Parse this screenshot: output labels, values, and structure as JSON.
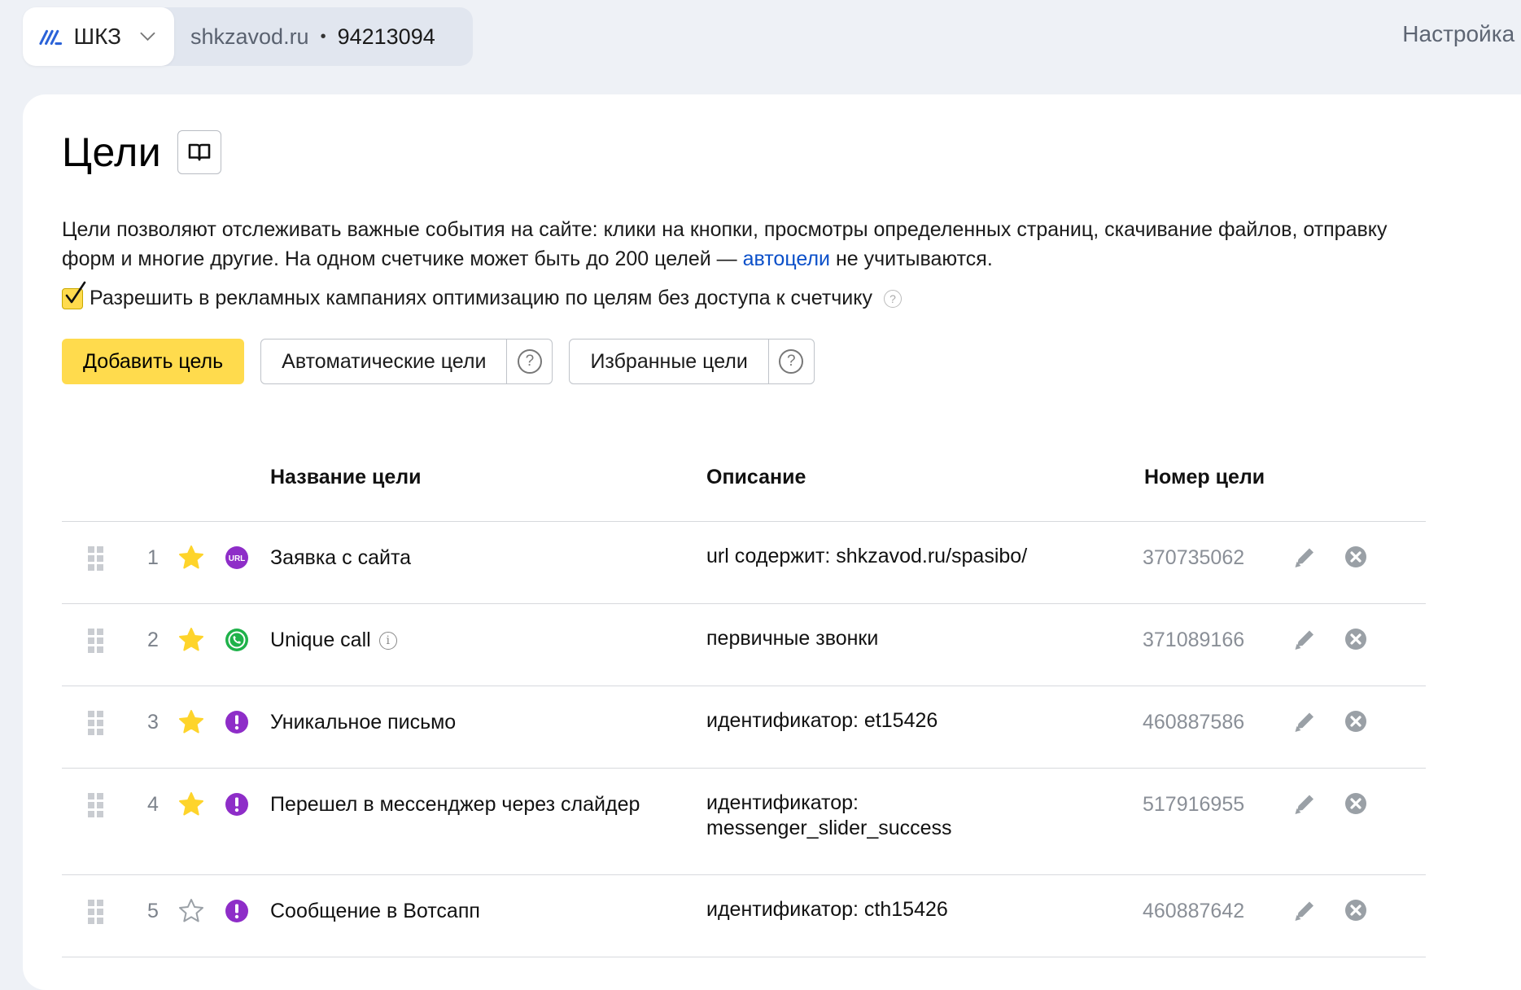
{
  "header": {
    "brand_name": "ШКЗ",
    "site": "shkzavod.ru",
    "separator": "•",
    "counter_id": "94213094",
    "right_link": "Настройка акк"
  },
  "page": {
    "title": "Цели",
    "intro_1": "Цели позволяют отслеживать важные события на сайте: клики на кнопки, просмотры определенных страниц, скачивание файлов, отправку форм и многие другие. На одном счетчике может быть до 200 целей — ",
    "intro_link": "автоцели",
    "intro_2": " не учитываются.",
    "checkbox_label": "Разрешить в рекламных кампаниях оптимизацию по целям без доступа к счетчику",
    "checkbox_checked": true
  },
  "buttons": {
    "add_goal": "Добавить цель",
    "auto_goals": "Автоматические цели",
    "favorite_goals": "Избранные цели",
    "help_glyph": "?"
  },
  "table": {
    "headers": {
      "name": "Название цели",
      "description": "Описание",
      "number": "Номер цели"
    },
    "rows": [
      {
        "index": "1",
        "favorite": true,
        "icon": "url-icon",
        "name": "Заявка с сайта",
        "description": "url содержит: shkzavod.ru/spasibo/",
        "goal_id": "370735062",
        "info": false
      },
      {
        "index": "2",
        "favorite": true,
        "icon": "call-icon",
        "name": "Unique call",
        "description": "первичные звонки",
        "goal_id": "371089166",
        "info": true
      },
      {
        "index": "3",
        "favorite": true,
        "icon": "event-icon",
        "name": "Уникальное письмо",
        "description": "идентификатор: et15426",
        "goal_id": "460887586",
        "info": false
      },
      {
        "index": "4",
        "favorite": true,
        "icon": "event-icon",
        "name": "Перешел в мессенджер через слайдер",
        "description": "идентификатор: messenger_slider_success",
        "goal_id": "517916955",
        "info": false
      },
      {
        "index": "5",
        "favorite": false,
        "icon": "event-icon",
        "name": "Сообщение в Вотсапп",
        "description": "идентификатор: cth15426",
        "goal_id": "460887642",
        "info": false
      }
    ]
  },
  "colors": {
    "accent_yellow": "#ffdb4d",
    "link_blue": "#0a4fc9",
    "star_yellow": "#fed42b",
    "goal_purple": "#8e2dc8",
    "call_green": "#1fb24a"
  }
}
